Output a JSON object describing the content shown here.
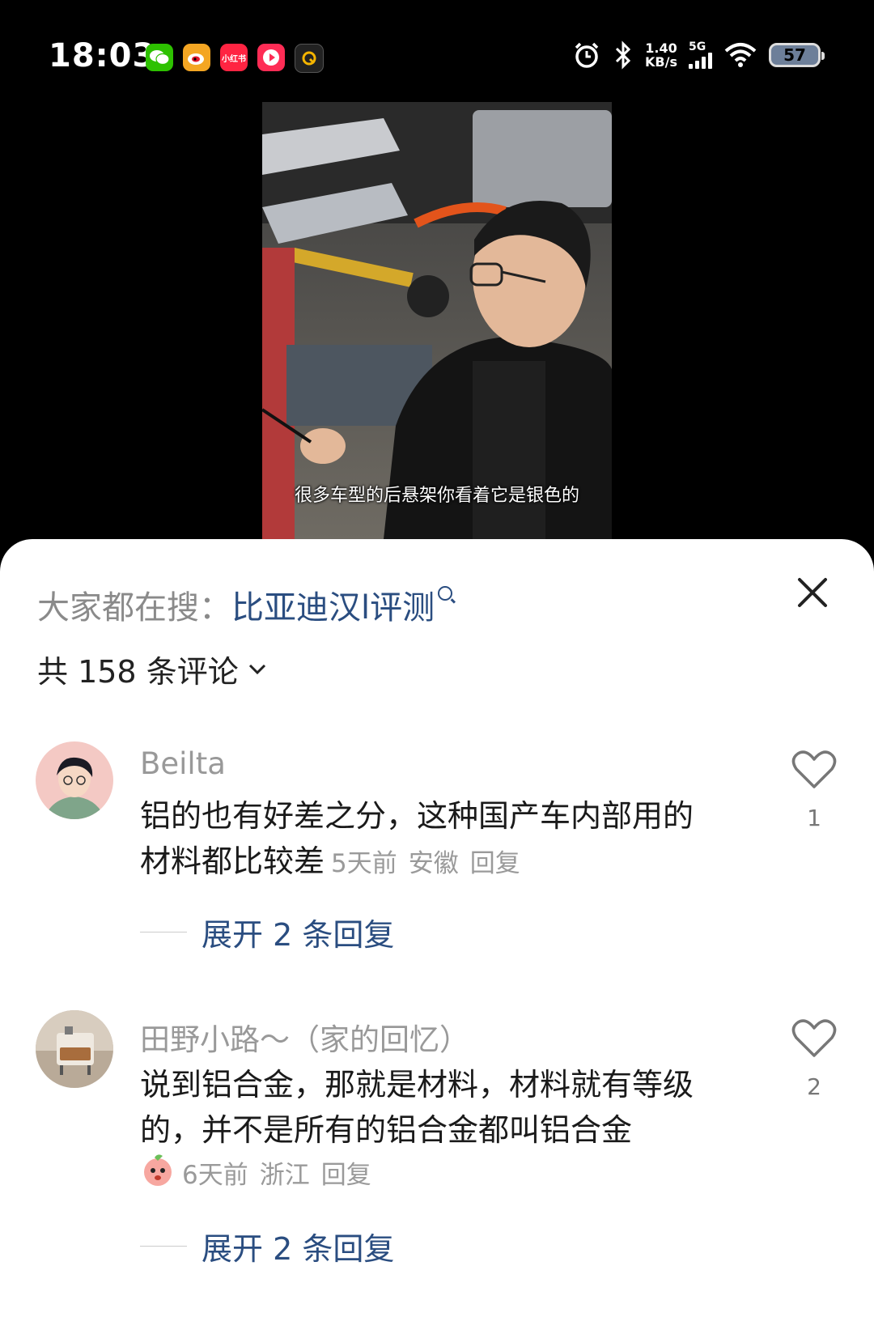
{
  "status_bar": {
    "time": "18:03",
    "app_icons": [
      {
        "name": "wechat-icon",
        "color": "#2dc100",
        "label": ""
      },
      {
        "name": "weibo-icon",
        "color": "#f4a623",
        "label": ""
      },
      {
        "name": "xiaohongshu-icon",
        "color": "#ff2442",
        "label": "小红书"
      },
      {
        "name": "video-app-icon",
        "color": "#fe2c55",
        "label": ""
      },
      {
        "name": "q-app-icon",
        "color": "#222222",
        "label": ""
      }
    ],
    "net_speed_value": "1.40",
    "net_speed_unit": "KB/s",
    "network": "5G",
    "battery": "57"
  },
  "video": {
    "subtitle": "很多车型的后悬架你看着它是银色的"
  },
  "sheet": {
    "hot_search_prefix": "大家都在搜：",
    "hot_search_term": "比亚迪汉l评测",
    "comment_count_label": "共 158 条评论"
  },
  "comments": [
    {
      "user": "Beilta",
      "text": "铝的也有好差之分，这种国产车内部用的材料都比较差",
      "time": "5天前",
      "location": "安徽",
      "reply_label": "回复",
      "likes": "1",
      "expand_label": "展开 2 条回复"
    },
    {
      "user": "田野小路～（家的回忆）",
      "text": "说到铝合金，那就是材料，材料就有等级的，并不是所有的铝合金都叫铝合金",
      "time": "6天前",
      "location": "浙江",
      "reply_label": "回复",
      "likes": "2",
      "expand_label": "展开 2 条回复"
    }
  ]
}
